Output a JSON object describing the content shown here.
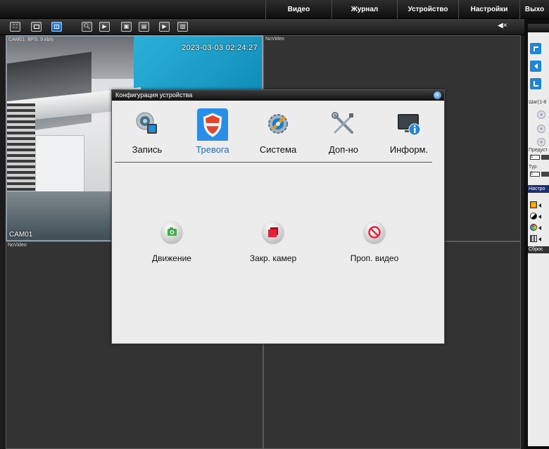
{
  "menu": {
    "items": [
      {
        "label": "Видео"
      },
      {
        "label": "Журнал"
      },
      {
        "label": "Устройство"
      },
      {
        "label": "Настройки"
      },
      {
        "label": "Выхо"
      }
    ]
  },
  "toolbar": {
    "buttons": [
      "fullscreen-icon",
      "single-view-icon",
      "quad-view-icon",
      "zoom-icon",
      "play-icon",
      "record-icon",
      "snapshot-icon",
      "playback-icon",
      "multi-screen-icon"
    ],
    "mute_glyph": "◀×"
  },
  "video": {
    "cam01_info": "CAM01: BPS: 9 kb/s",
    "cam01_timestamp": "2023-03-03 02:24:27",
    "cam01_name": "CAM01",
    "novideo": "NoVideo"
  },
  "right_panel": {
    "step_label": "Шаг(1-8",
    "preset_label": "Предуст",
    "preset_value": "1",
    "tour_label": "Тур:",
    "tour_value": "1",
    "settings_label": "Настро",
    "reset_label": "Сброс"
  },
  "dialog": {
    "title": "Конфигурация устройства",
    "close_glyph": "×",
    "tabs": [
      {
        "label": "Запись",
        "icon": "record-icon"
      },
      {
        "label": "Тревога",
        "icon": "alarm-shield-icon"
      },
      {
        "label": "Система",
        "icon": "system-gear-icon"
      },
      {
        "label": "Доп-но",
        "icon": "tools-icon"
      },
      {
        "label": "Информ.",
        "icon": "info-monitor-icon"
      }
    ],
    "active_tab": "Тревога",
    "functions": [
      {
        "label": "Движение",
        "icon": "camera-icon",
        "color": "#3fae49"
      },
      {
        "label": "Закр. камер",
        "icon": "camera-blind-icon",
        "color": "#e8203c"
      },
      {
        "label": "Проп. видео",
        "icon": "video-loss-icon",
        "color": "#e8203c"
      }
    ]
  },
  "colors": {
    "accent": "#1f6ed0",
    "dialog_bg": "#ececec",
    "panel_bg": "#333333"
  }
}
